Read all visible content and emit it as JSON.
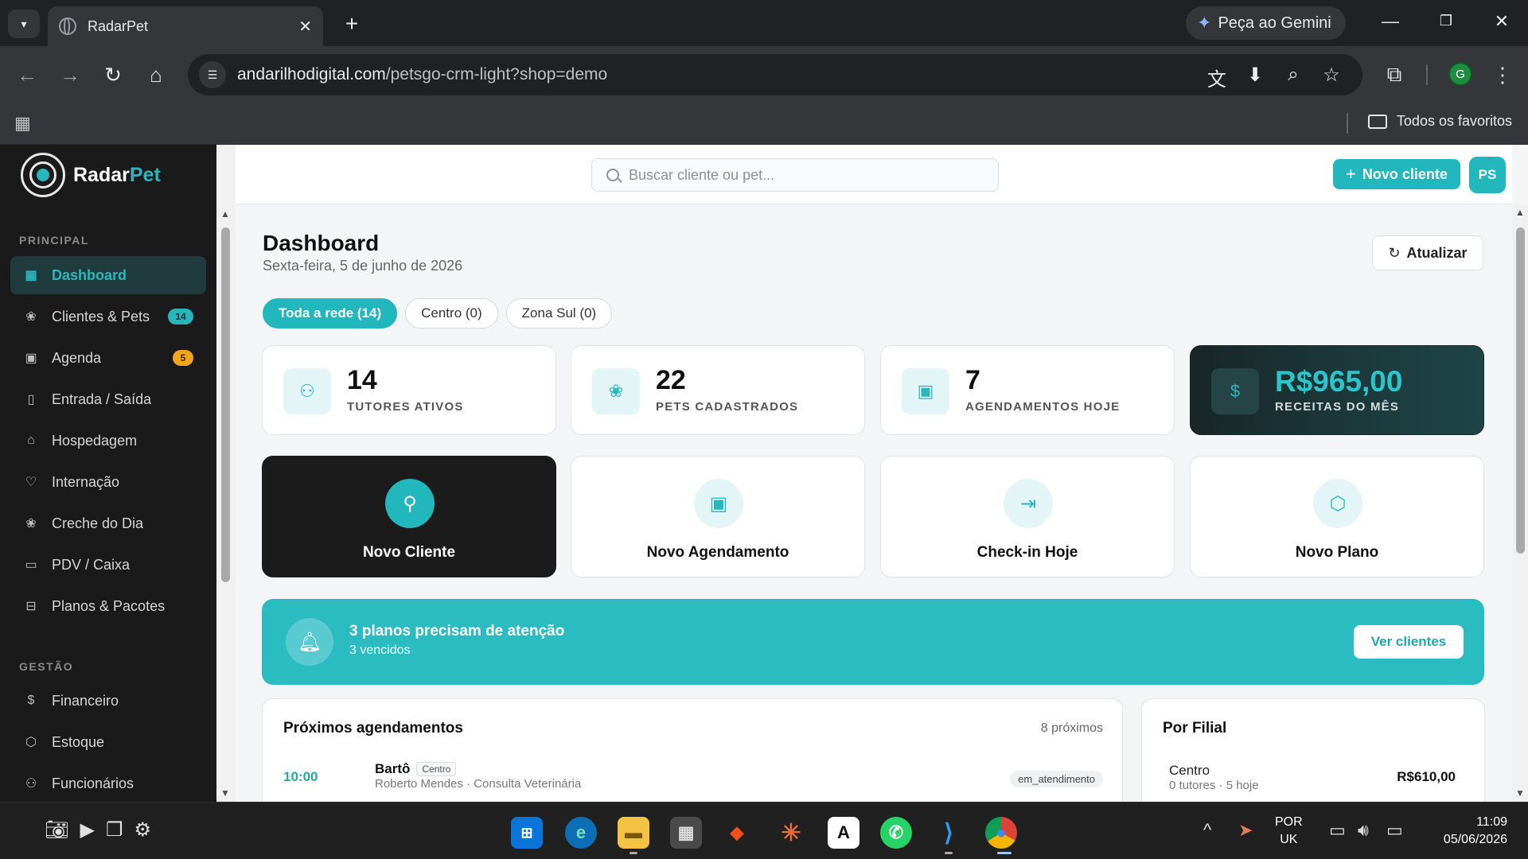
{
  "browser": {
    "tab_title": "RadarPet",
    "gemini_label": "Peça ao Gemini",
    "url_host": "andarilhodigital.com",
    "url_path": "/petsgo-crm-light?shop=demo",
    "profile_initial": "G",
    "bookmarks_folder": "Todos os favoritos"
  },
  "sidebar": {
    "brand_main": "Radar",
    "brand_accent": "Pet",
    "section_principal": "PRINCIPAL",
    "section_gestao": "GESTÃO",
    "items": [
      {
        "label": "Dashboard",
        "icon": "grid-icon"
      },
      {
        "label": "Clientes & Pets",
        "icon": "paw-icon",
        "badge": "14"
      },
      {
        "label": "Agenda",
        "icon": "calendar-icon",
        "badge": "5"
      },
      {
        "label": "Entrada / Saída",
        "icon": "door-icon"
      },
      {
        "label": "Hospedagem",
        "icon": "home-icon"
      },
      {
        "label": "Internação",
        "icon": "heart-pulse-icon"
      },
      {
        "label": "Creche do Dia",
        "icon": "paw-icon"
      },
      {
        "label": "PDV / Caixa",
        "icon": "monitor-icon"
      },
      {
        "label": "Planos & Pacotes",
        "icon": "ticket-icon"
      },
      {
        "label": "Financeiro",
        "icon": "dollar-icon"
      },
      {
        "label": "Estoque",
        "icon": "box-icon"
      },
      {
        "label": "Funcionários",
        "icon": "users-icon"
      }
    ]
  },
  "topbar": {
    "search_placeholder": "Buscar cliente ou pet...",
    "new_client_label": "Novo cliente",
    "user_initials": "PS"
  },
  "dashboard": {
    "title": "Dashboard",
    "date": "Sexta-feira, 5 de junho de 2026",
    "refresh_label": "Atualizar",
    "filters": [
      "Toda a rede (14)",
      "Centro (0)",
      "Zona Sul (0)"
    ],
    "stats": [
      {
        "value": "14",
        "label": "TUTORES ATIVOS",
        "icon": "users-icon"
      },
      {
        "value": "22",
        "label": "PETS CADASTRADOS",
        "icon": "paw-icon"
      },
      {
        "value": "7",
        "label": "AGENDAMENTOS HOJE",
        "icon": "calendar-check-icon"
      },
      {
        "value": "R$965,00",
        "label": "RECEITAS DO MÊS",
        "icon": "dollar-circle-icon"
      }
    ],
    "actions": [
      {
        "label": "Novo Cliente",
        "icon": "user-plus-icon"
      },
      {
        "label": "Novo Agendamento",
        "icon": "calendar-plus-icon"
      },
      {
        "label": "Check-in Hoje",
        "icon": "login-icon"
      },
      {
        "label": "Novo Plano",
        "icon": "package-icon"
      }
    ],
    "alert": {
      "title": "3 planos precisam de atenção",
      "subtitle": "3 vencidos",
      "button": "Ver clientes"
    },
    "appointments": {
      "title": "Próximos agendamentos",
      "meta": "8 próximos",
      "rows": [
        {
          "time": "10:00",
          "pet": "Bartô",
          "branch": "Centro",
          "detail": "Roberto Mendes · Consulta Veterinária",
          "status": "em_atendimento"
        }
      ]
    },
    "branches": {
      "title": "Por Filial",
      "rows": [
        {
          "name": "Centro",
          "detail": "0 tutores · 5 hoje",
          "value": "R$610,00"
        }
      ]
    }
  },
  "taskbar": {
    "lang_top": "POR",
    "lang_bottom": "UK",
    "time": "11:09",
    "date": "05/06/2026"
  }
}
